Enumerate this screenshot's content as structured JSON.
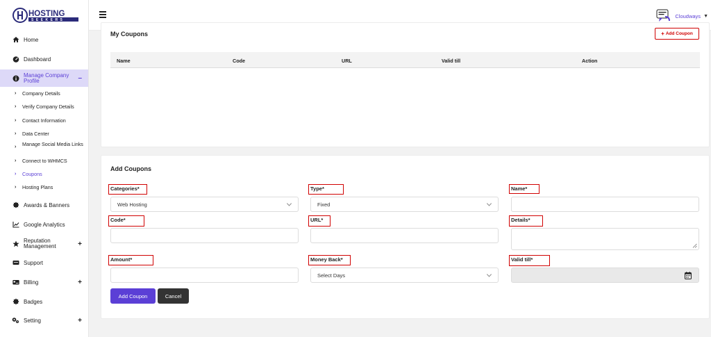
{
  "brand": {
    "name": "HOSTING",
    "tagline": "SEEKERS"
  },
  "topbar": {
    "user_name": "Cloudways"
  },
  "sidebar": {
    "items": [
      {
        "label": "Home",
        "icon": "home-icon"
      },
      {
        "label": "Dashboard",
        "icon": "dashboard-icon"
      },
      {
        "label": "Manage Company Profile",
        "icon": "info-icon",
        "toggle": "–"
      },
      {
        "label": "Awards & Banners",
        "icon": "badge-icon"
      },
      {
        "label": "Google Analytics",
        "icon": "chart-icon"
      },
      {
        "label": "Reputation Management",
        "icon": "star-icon",
        "toggle": "+"
      },
      {
        "label": "Support",
        "icon": "support-icon"
      },
      {
        "label": "Billing",
        "icon": "billing-icon",
        "toggle": "+"
      },
      {
        "label": "Badges",
        "icon": "badge-icon"
      },
      {
        "label": "Setting",
        "icon": "gear-icon",
        "toggle": "+"
      }
    ],
    "sub_items": [
      "Company Details",
      "Verify Company Details",
      "Contact Information",
      "Data Center",
      "Manage Social Media Links",
      "Connect to WHMCS",
      "Coupons",
      "Hosting Plans"
    ]
  },
  "my_coupons": {
    "title": "My Coupons",
    "add_button": "Add Coupon",
    "columns": [
      "Name",
      "Code",
      "URL",
      "Valid till",
      "Action"
    ]
  },
  "add_coupons": {
    "title": "Add Coupons",
    "fields": {
      "categories": {
        "label": "Categories*",
        "value": "Web Hosting"
      },
      "type": {
        "label": "Type*",
        "value": "Fixed"
      },
      "name": {
        "label": "Name*",
        "value": ""
      },
      "code": {
        "label": "Code*",
        "value": ""
      },
      "url": {
        "label": "URL*",
        "value": ""
      },
      "details": {
        "label": "Details*",
        "value": ""
      },
      "amount": {
        "label": "Amount*",
        "value": ""
      },
      "money_back": {
        "label": "Money Back*",
        "value": "Select Days"
      },
      "valid_till": {
        "label": "Valid till*",
        "value": ""
      }
    },
    "submit": "Add Coupon",
    "cancel": "Cancel"
  },
  "colors": {
    "accent": "#5b3fd6",
    "highlight": "#d00000",
    "active_bg": "#ddd9f8"
  }
}
